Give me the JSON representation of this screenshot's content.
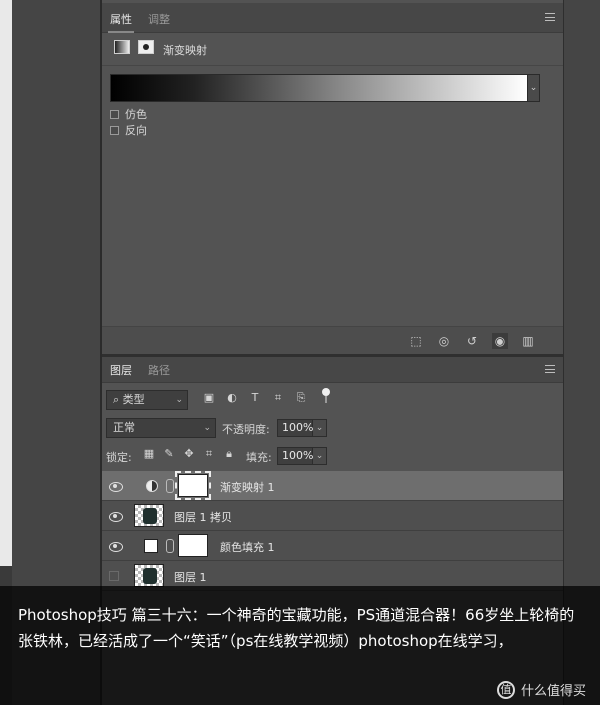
{
  "properties_panel": {
    "tabs": [
      {
        "label": "属性"
      },
      {
        "label": "调整"
      }
    ],
    "adjustment_title": "渐变映射",
    "checkboxes": [
      {
        "label": "仿色"
      },
      {
        "label": "反向"
      }
    ],
    "footer_icons": [
      "clip-to-layer-icon",
      "view-previous-icon",
      "reset-icon",
      "visibility-icon",
      "trash-icon"
    ]
  },
  "layers_panel": {
    "tabs": [
      {
        "label": "图层"
      },
      {
        "label": "路径"
      }
    ],
    "filter_kind": "类型",
    "blend_mode": "正常",
    "opacity_label": "不透明度:",
    "opacity_value": "100%",
    "lock_label": "锁定:",
    "fill_label": "填充:",
    "fill_value": "100%",
    "layers": [
      {
        "name": "渐变映射 1"
      },
      {
        "name": "图层 1 拷贝"
      },
      {
        "name": "颜色填充 1"
      },
      {
        "name": "图层 1"
      }
    ]
  },
  "caption": {
    "text": "Photoshop技巧 篇三十六：一个神奇的宝藏功能，PS通道混合器！66岁坐上轮椅的张铁林，已经活成了一个“笑话”（ps在线教学视频）photoshop在线学习，"
  },
  "watermark": {
    "logo": "值",
    "text": "什么值得买"
  }
}
